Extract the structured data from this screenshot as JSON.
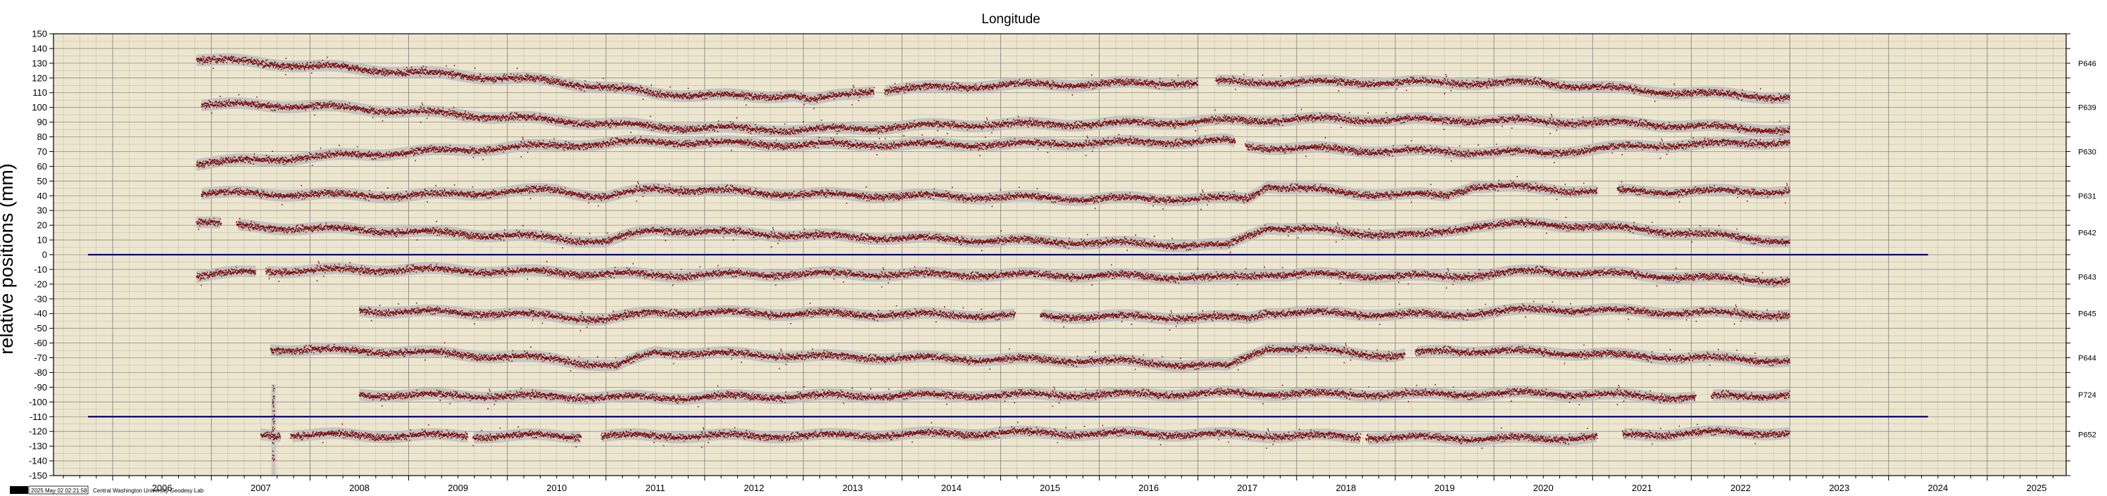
{
  "chart_data": {
    "type": "scatter",
    "title": "Longitude",
    "xlabel": "",
    "ylabel": "relative positions (mm)",
    "xlim": [
      2005.4,
      2025.8
    ],
    "ylim": [
      -150,
      150
    ],
    "yticks": [
      150,
      140,
      130,
      120,
      110,
      100,
      90,
      80,
      70,
      60,
      50,
      40,
      30,
      20,
      10,
      0,
      -10,
      -20,
      -30,
      -40,
      -50,
      -60,
      -70,
      -80,
      -90,
      -100,
      -110,
      -120,
      -130,
      -140,
      -150
    ],
    "xticks": [
      2006,
      2007,
      2008,
      2009,
      2010,
      2011,
      2012,
      2013,
      2014,
      2015,
      2016,
      2017,
      2018,
      2019,
      2020,
      2021,
      2022,
      2023,
      2024,
      2025
    ],
    "grid": true,
    "reference_lines": [
      {
        "y": 0,
        "x_range": [
          2005.75,
          2024.4
        ],
        "color": "#00008b"
      },
      {
        "y": -110,
        "x_range": [
          2005.75,
          2024.4
        ],
        "color": "#00008b"
      }
    ],
    "series": [
      {
        "name": "P646",
        "start": 2006.85,
        "end": 2023.0,
        "offset": 130,
        "drift": -1.2,
        "gaps": [
          [
            2013.72,
            2013.82
          ],
          [
            2017.0,
            2017.18
          ]
        ],
        "wave": [
          [
            2006.85,
            3
          ],
          [
            2008.5,
            -2
          ],
          [
            2010.5,
            -8
          ],
          [
            2011.5,
            -15
          ],
          [
            2012.5,
            -16
          ],
          [
            2012.9,
            -14
          ],
          [
            2013.1,
            -18
          ],
          [
            2013.7,
            -10
          ],
          [
            2015.0,
            -5
          ],
          [
            2016.5,
            -2
          ],
          [
            2017.5,
            0
          ],
          [
            2019.5,
            2
          ],
          [
            2020.5,
            3
          ],
          [
            2021.5,
            -1
          ],
          [
            2023.0,
            -4
          ]
        ]
      },
      {
        "name": "P639",
        "start": 2006.9,
        "end": 2023.0,
        "offset": 100,
        "drift": -0.9,
        "gaps": [],
        "wave": [
          [
            2006.9,
            2
          ],
          [
            2008,
            2
          ],
          [
            2010,
            -4
          ],
          [
            2011.5,
            -9
          ],
          [
            2013,
            -10
          ],
          [
            2014.5,
            -5
          ],
          [
            2016,
            -3
          ],
          [
            2018,
            2
          ],
          [
            2020,
            3
          ],
          [
            2021.5,
            2
          ],
          [
            2023.0,
            -1
          ]
        ]
      },
      {
        "name": "P630",
        "start": 2006.85,
        "end": 2023.0,
        "offset": 70,
        "drift": 0.6,
        "gaps": [
          [
            2017.38,
            2017.48
          ]
        ],
        "wave": [
          [
            2006.85,
            -8
          ],
          [
            2008.5,
            -3
          ],
          [
            2010.5,
            2
          ],
          [
            2011.5,
            4
          ],
          [
            2013,
            1
          ],
          [
            2015,
            0
          ],
          [
            2017.3,
            1
          ],
          [
            2017.5,
            -3
          ],
          [
            2019,
            -7
          ],
          [
            2020.5,
            -9
          ],
          [
            2021.5,
            -5
          ],
          [
            2023.0,
            -3
          ]
        ]
      },
      {
        "name": "P631",
        "start": 2006.9,
        "end": 2023.0,
        "offset": 40,
        "drift": 0.0,
        "gaps": [
          [
            2021.05,
            2021.25
          ]
        ],
        "wave": [
          [
            2006.9,
            2
          ],
          [
            2009,
            0
          ],
          [
            2010.5,
            4
          ],
          [
            2011.0,
            -1
          ],
          [
            2011.5,
            5
          ],
          [
            2013,
            1
          ],
          [
            2016,
            -2
          ],
          [
            2017.5,
            -2
          ],
          [
            2017.7,
            7
          ],
          [
            2018.5,
            2
          ],
          [
            2019.5,
            0
          ],
          [
            2019.8,
            7
          ],
          [
            2021,
            3
          ],
          [
            2023.0,
            3
          ]
        ]
      },
      {
        "name": "P642",
        "start": 2006.85,
        "end": 2023.0,
        "offset": 15,
        "drift": 0.0,
        "gaps": [
          [
            2007.1,
            2007.25
          ]
        ],
        "wave": [
          [
            2006.85,
            8
          ],
          [
            2007.0,
            7
          ],
          [
            2007.3,
            4
          ],
          [
            2008.5,
            2
          ],
          [
            2010,
            -2
          ],
          [
            2011,
            -6
          ],
          [
            2011.5,
            2
          ],
          [
            2013,
            -2
          ],
          [
            2016,
            -7
          ],
          [
            2017.3,
            -9
          ],
          [
            2017.7,
            4
          ],
          [
            2018.5,
            0
          ],
          [
            2019.3,
            -2
          ],
          [
            2019.8,
            5
          ],
          [
            2020.5,
            6
          ],
          [
            2021.5,
            2
          ],
          [
            2023.0,
            -6
          ]
        ]
      },
      {
        "name": "P643",
        "start": 2006.85,
        "end": 2023.0,
        "offset": -15,
        "drift": 0.0,
        "gaps": [
          [
            2007.45,
            2007.55
          ]
        ],
        "wave": [
          [
            2006.85,
            1
          ],
          [
            2007.4,
            3
          ],
          [
            2007.6,
            4
          ],
          [
            2009,
            5
          ],
          [
            2010.5,
            3
          ],
          [
            2011.5,
            1
          ],
          [
            2013,
            2
          ],
          [
            2016,
            1
          ],
          [
            2017.3,
            -1
          ],
          [
            2017.7,
            2
          ],
          [
            2019.5,
            0
          ],
          [
            2020.5,
            4
          ],
          [
            2023.0,
            -3
          ]
        ]
      },
      {
        "name": "P645",
        "start": 2008.5,
        "end": 2023.0,
        "offset": -40,
        "drift": 0.0,
        "gaps": [
          [
            2015.15,
            2015.4
          ]
        ],
        "wave": [
          [
            2008.5,
            2
          ],
          [
            2010,
            0
          ],
          [
            2011.0,
            -4
          ],
          [
            2011.5,
            1
          ],
          [
            2013,
            0
          ],
          [
            2016,
            -2
          ],
          [
            2017.5,
            -3
          ],
          [
            2017.7,
            1
          ],
          [
            2019.5,
            -1
          ],
          [
            2020.5,
            3
          ],
          [
            2023.0,
            -1
          ]
        ]
      },
      {
        "name": "P644",
        "start": 2007.6,
        "end": 2023.0,
        "offset": -70,
        "drift": 0.0,
        "gaps": [
          [
            2019.1,
            2019.2
          ]
        ],
        "wave": [
          [
            2007.6,
            6
          ],
          [
            2009,
            4
          ],
          [
            2010.5,
            -1
          ],
          [
            2011.1,
            -6
          ],
          [
            2011.5,
            4
          ],
          [
            2013,
            1
          ],
          [
            2016,
            -2
          ],
          [
            2017.3,
            -6
          ],
          [
            2017.7,
            7
          ],
          [
            2018.5,
            4
          ],
          [
            2019.0,
            1
          ],
          [
            2019.5,
            5
          ],
          [
            2020.5,
            4
          ],
          [
            2021.5,
            1
          ],
          [
            2023.0,
            -2
          ]
        ]
      },
      {
        "name": "P724",
        "start": 2008.5,
        "end": 2023.0,
        "offset": -95,
        "drift": 0.0,
        "gaps": [
          [
            2022.05,
            2022.2
          ]
        ],
        "wave": [
          [
            2008.5,
            0
          ],
          [
            2010,
            -1
          ],
          [
            2011.5,
            -2
          ],
          [
            2013,
            -1
          ],
          [
            2016,
            0
          ],
          [
            2017.5,
            1
          ],
          [
            2019,
            0
          ],
          [
            2020.5,
            1
          ],
          [
            2022,
            -2
          ],
          [
            2023.0,
            0
          ]
        ]
      },
      {
        "name": "P652",
        "start": 2007.5,
        "end": 2023.0,
        "offset": -122,
        "drift": 0.0,
        "gaps": [
          [
            2007.7,
            2007.8
          ],
          [
            2009.6,
            2009.65
          ],
          [
            2010.75,
            2010.95
          ],
          [
            2018.65,
            2018.7
          ],
          [
            2021.05,
            2021.3
          ]
        ],
        "wave": [
          [
            2007.5,
            0
          ],
          [
            2009,
            -1
          ],
          [
            2011,
            -1
          ],
          [
            2013,
            -1
          ],
          [
            2015,
            1
          ],
          [
            2017,
            0
          ],
          [
            2019,
            -2
          ],
          [
            2020.5,
            -3
          ],
          [
            2022,
            1
          ],
          [
            2023.0,
            1
          ]
        ]
      }
    ],
    "spike": {
      "x": 2007.63,
      "y_range": [
        -150,
        -88
      ]
    },
    "colors": {
      "background": "#ede6cf",
      "grid": "#6f6f6f",
      "points": "#7a0c0c",
      "envelope": "#bdbdbd",
      "reference": "#00008b"
    }
  },
  "footer": {
    "badge": "GMT",
    "timestamp": "2025 May 02 02:21:58",
    "credit": "Central Washington University Geodesy Lab"
  }
}
